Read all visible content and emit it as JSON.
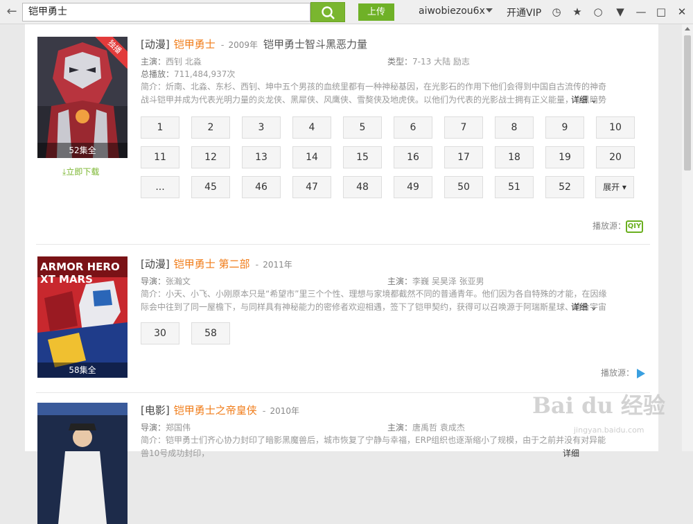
{
  "toolbar": {
    "search_value": "铠甲勇士",
    "upload_label": "上传",
    "username": "aiwobiezou6x",
    "vip_label": "开通VIP"
  },
  "icons": {
    "back": "back-arrow-icon",
    "search": "search-icon",
    "history": "clock-icon",
    "favorite": "star-icon",
    "message": "chat-icon",
    "menu": "menu-icon",
    "minimize": "minimize-icon",
    "maximize": "maximize-icon",
    "close": "close-icon"
  },
  "results": [
    {
      "category": "[动漫]",
      "name": "铠甲勇士",
      "year": "2009年",
      "subtitle": "铠甲勇士智斗黑恶力量",
      "cast_label": "主演：",
      "cast": "西钊 北淼",
      "type_label": "类型：",
      "type": "7-13 大陆 励志",
      "plays_label": "总播放：",
      "plays": "711,484,937次",
      "desc_label": "简介：",
      "desc": "炘南、北淼、东杉、西钊、坤中五个男孩的血统里都有一种神秘基因，在光影石的作用下他们会得到中国自古流传的神奇战斗铠甲并成为代表光明力量的炎龙侠、黑犀侠、风鹰侠、雪獒侠及地虎侠。以他们为代表的光影战士拥有正义能量，与黑暗势力黑帝及其爪...",
      "detail": "详细",
      "badge": "独播",
      "episodes_count": "52集全",
      "download": "立即下载",
      "episodes": [
        "1",
        "2",
        "3",
        "4",
        "5",
        "6",
        "7",
        "8",
        "9",
        "10",
        "11",
        "12",
        "13",
        "14",
        "15",
        "16",
        "17",
        "18",
        "19",
        "20",
        "...",
        "45",
        "46",
        "47",
        "48",
        "49",
        "50",
        "51",
        "52"
      ],
      "expand": "展开",
      "source_label": "播放源：",
      "source": "QIY"
    },
    {
      "category": "[动漫]",
      "name": "铠甲勇士 第二部",
      "year": "2011年",
      "director_label": "导演：",
      "director": "张瀚文",
      "cast_label": "主演：",
      "cast": "李巍 吴昊泽 张亚男",
      "desc_label": "简介：",
      "desc": "小天、小飞、小刚原本只是“希望市”里三个个性、理想与家境都截然不同的普通青年。他们因为各自特殊的才能，在因缘际会中往到了同一屋檐下，与同样具有神秘能力的密修者欢迎相遇，签下了铠甲契约，获得可以召唤源于阿瑞斯星球、结合宇宙最高科技结...",
      "detail": "详细",
      "episodes_count": "58集全",
      "poster_text": "ARMOR HERO XT MARS",
      "episodes": [
        "30",
        "58"
      ],
      "source_label": "播放源："
    },
    {
      "category": "[电影]",
      "name": "铠甲勇士之帝皇侠",
      "year": "2010年",
      "director_label": "导演：",
      "director": "郑国伟",
      "cast_label": "主演：",
      "cast": "唐禹哲 袁成杰",
      "desc_label": "简介：",
      "desc": "铠甲勇士们齐心协力封印了暗影黑魔兽后，城市恢复了宁静与幸福，ERP组织也逐渐缩小了规模，由于之前并没有对异能兽10号成功封印，",
      "detail": "详细"
    }
  ],
  "watermark": {
    "text": "Bai du 经验",
    "url": "jingyan.baidu.com"
  }
}
